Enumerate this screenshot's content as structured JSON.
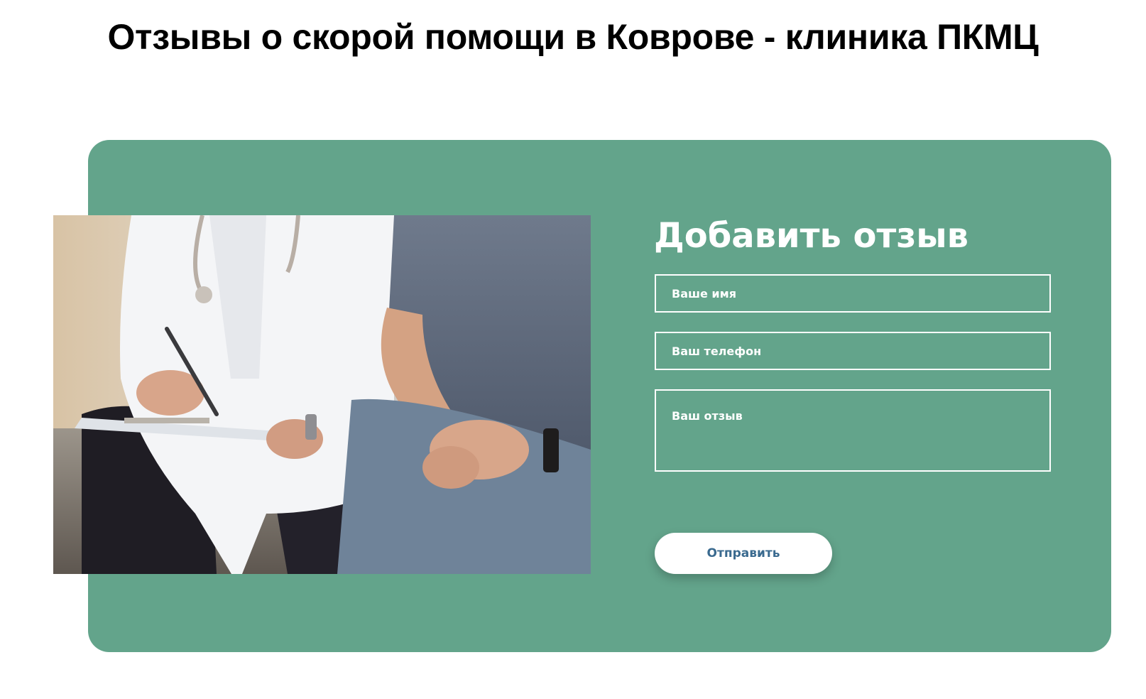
{
  "page": {
    "title": "Отзывы о скорой помощи в Коврове - клиника ПКМЦ"
  },
  "form": {
    "title": "Добавить отзыв",
    "name_placeholder": "Ваше имя",
    "phone_placeholder": "Ваш телефон",
    "review_placeholder": "Ваш отзыв",
    "submit_label": "Отправить"
  },
  "colors": {
    "card_background": "#63a48b",
    "button_text": "#3a6a8f"
  }
}
